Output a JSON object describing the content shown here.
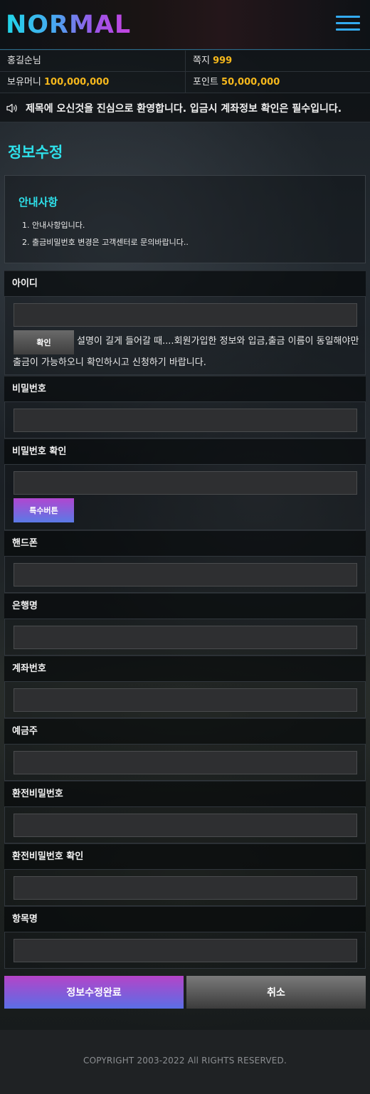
{
  "header": {
    "logo": "NORMAL"
  },
  "user": {
    "name": "홍길순님",
    "message_label": "쪽지",
    "message_count": "999",
    "money_label": "보유머니",
    "money_value": "100,000,000",
    "point_label": "포인트",
    "point_value": "50,000,000"
  },
  "notice": {
    "icon": "speaker-icon",
    "text": "제목에 오신것을 진심으로 환영합니다. 입금시 계좌정보 확인은 필수입니다."
  },
  "page": {
    "title": "정보수정"
  },
  "guide": {
    "title": "안내사항",
    "items": [
      "1. 안내사항입니다.",
      "2. 출금비밀번호 변경은 고객센터로 문의바랍니다.."
    ]
  },
  "form": {
    "id": {
      "label": "아이디",
      "value": "",
      "confirm_button": "확인",
      "desc_line1": "설명이 길게 들어갈 때....회원가입한 정보와 입금,출금 이름이 동일해야만",
      "desc_line2": "출금이 가능하오니 확인하시고 신청하기 바랍니다."
    },
    "password": {
      "label": "비밀번호",
      "value": ""
    },
    "password_confirm": {
      "label": "비밀번호 확인",
      "value": "",
      "special_button": "특수버튼"
    },
    "phone": {
      "label": "핸드폰",
      "value": ""
    },
    "bank": {
      "label": "은행명",
      "value": ""
    },
    "account": {
      "label": "계좌번호",
      "value": ""
    },
    "holder": {
      "label": "예금주",
      "value": ""
    },
    "withdraw_password": {
      "label": "환전비밀번호",
      "value": ""
    },
    "withdraw_password_confirm": {
      "label": "환전비밀번호 확인",
      "value": ""
    },
    "item": {
      "label": "항목명",
      "value": ""
    }
  },
  "actions": {
    "submit": "정보수정완료",
    "cancel": "취소"
  },
  "footer": {
    "copyright": "COPYRIGHT 2003-2022 All RIGHTS RESERVED."
  },
  "colors": {
    "accent_cyan": "#2ee0ea",
    "highlight_yellow": "#f6b81c",
    "menu_blue": "#33aaf0"
  }
}
